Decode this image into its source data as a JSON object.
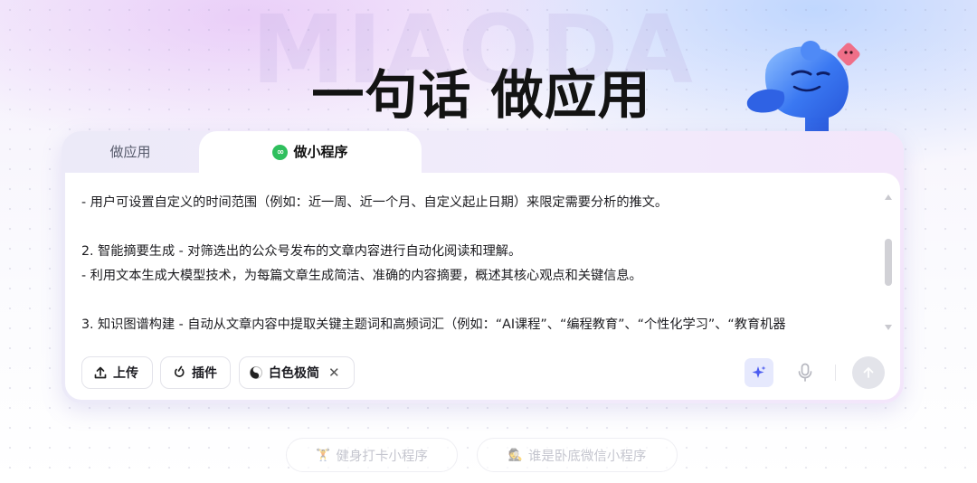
{
  "hero": {
    "watermark": "MIAODA",
    "headline": "一句话 做应用"
  },
  "tabs": [
    {
      "label": "做应用",
      "active": false
    },
    {
      "label": "做小程序",
      "active": true,
      "icon": "wechat-miniprogram-icon"
    }
  ],
  "prompt": {
    "lines": [
      "- 用户可设置自定义的时间范围（例如：近一周、近一个月、自定义起止日期）来限定需要分析的推文。",
      "",
      "2. 智能摘要生成 - 对筛选出的公众号发布的文章内容进行自动化阅读和理解。",
      "- 利用文本生成大模型技术，为每篇文章生成简洁、准确的内容摘要，概述其核心观点和关键信息。",
      "",
      "3. 知识图谱构建 - 自动从文章内容中提取关键主题词和高频词汇（例如：“AI课程”、“编程教育”、“个性化学习”、“教育机器"
    ]
  },
  "toolbar": {
    "upload_label": "上传",
    "plugin_label": "插件",
    "style_label": "白色极简",
    "style_close": "✕"
  },
  "suggestions": [
    {
      "label": "健身打卡小程序",
      "icon": "dumbbell-icon"
    },
    {
      "label": "谁是卧底微信小程序",
      "icon": "spy-icon"
    }
  ],
  "colors": {
    "accent": "#5b6cf5",
    "wechat_green": "#2fbf5d",
    "mascot_blue": "#2f6cf0",
    "mascot_pink": "#ef6f88"
  }
}
